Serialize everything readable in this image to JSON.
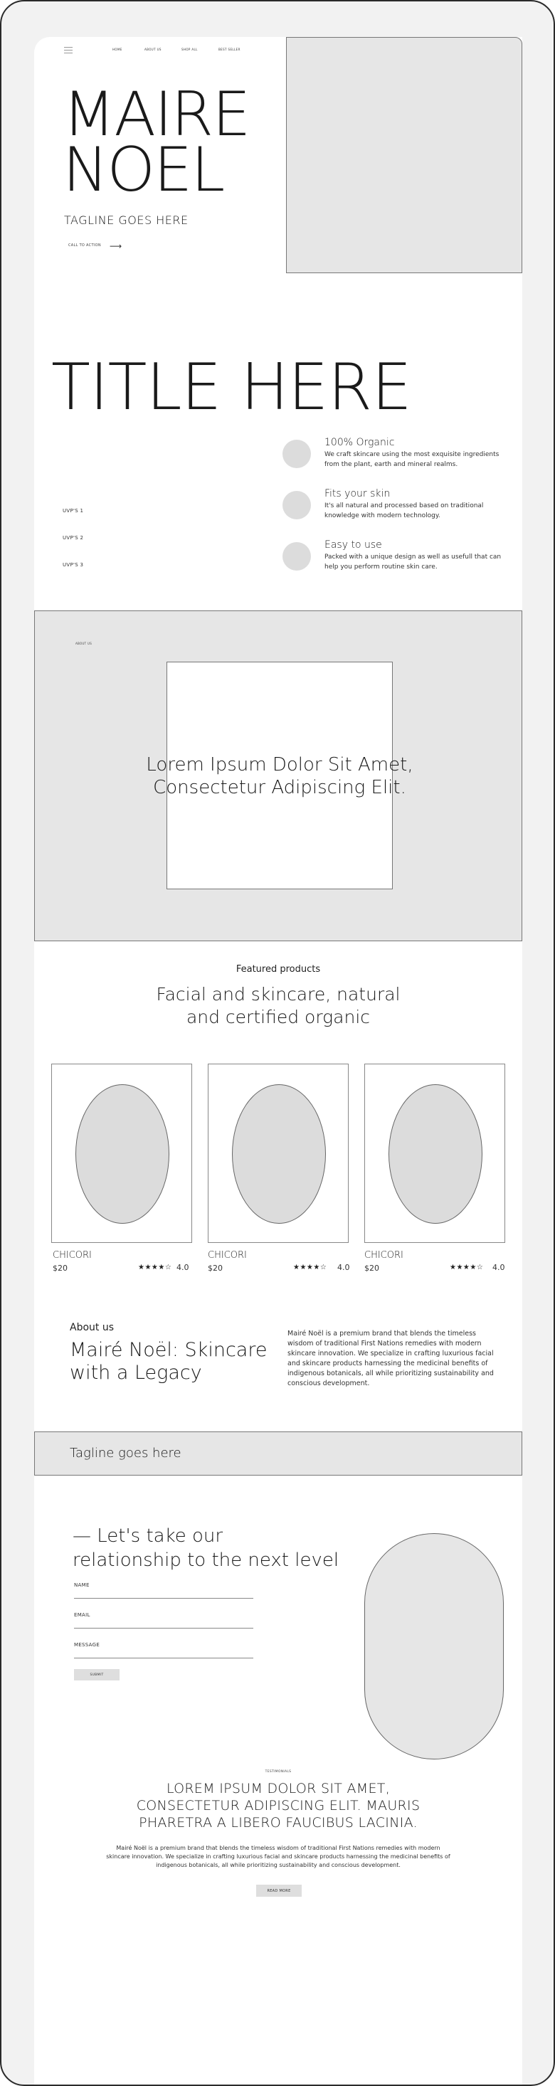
{
  "nav": {
    "links": [
      "HOME",
      "ABOUT US",
      "SHOP ALL",
      "BEST SELLER"
    ]
  },
  "hero": {
    "title": "MAIRE\nNOEL",
    "tagline": "TAGLINE GOES HERE",
    "cta": "CALL TO ACTION",
    "cta_arrow": "⟶"
  },
  "usp_section": {
    "title": "TITLE HERE",
    "usps": [
      "UVP'S 1",
      "UVP'S 2",
      "UVP'S 3"
    ],
    "features": [
      {
        "title": "100% Organic",
        "desc": "We craft skincare using the most exquisite ingredients from the plant, earth and mineral realms."
      },
      {
        "title": "Fits your skin",
        "desc": "It's all natural and processed based on traditional knowledge with modern technology."
      },
      {
        "title": "Easy to use",
        "desc": "Packed with a unique design as well as usefull that can help you perform routine skin care."
      }
    ]
  },
  "about_block": {
    "label": "ABOUT US",
    "headline": "Lorem Ipsum Dolor Sit Amet,\nConsectetur Adipiscing Elit."
  },
  "featured": {
    "label": "Featured products",
    "heading": "Facial and skincare, natural\nand certified organic",
    "products": [
      {
        "name": "CHICORI",
        "price": "$20",
        "stars": "★★★★☆",
        "rating": "4.0"
      },
      {
        "name": "CHICORI",
        "price": "$20",
        "stars": "★★★★☆",
        "rating": "4.0"
      },
      {
        "name": "CHICORI",
        "price": "$20",
        "stars": "★★★★☆",
        "rating": "4.0"
      }
    ]
  },
  "about_us": {
    "label": "About us",
    "title": "Mairé Noël: Skincare\nwith a Legacy",
    "text": "Mairé Noël is a premium brand that blends the timeless wisdom of traditional First Nations remedies with modern skincare innovation. We specialize in crafting luxurious facial and skincare products harnessing the medicinal benefits of indigenous botanicals, all while prioritizing sustainability and conscious development."
  },
  "tagline_bar": {
    "text": "Tagline goes here"
  },
  "contact": {
    "title": "— Let's take our\nrelationship to the next level",
    "fields": [
      "NAME",
      "EMAIL",
      "MESSAGE"
    ],
    "submit": "SUBMIT"
  },
  "testimonials": {
    "label": "TESTIMONIALS",
    "quote": "LOREM IPSUM DOLOR SIT AMET,\nCONSECTETUR ADIPISCING ELIT. MAURIS\nPHARETRA A LIBERO FAUCIBUS LACINIA.",
    "text": "Mairé Noël is a premium brand that blends the timeless wisdom of traditional First Nations remedies with modern skincare innovation. We specialize in crafting luxurious facial and skincare products harnessing the medicinal benefits of indigenous botanicals, all while prioritizing sustainability and conscious development.",
    "button": "READ MORE"
  }
}
